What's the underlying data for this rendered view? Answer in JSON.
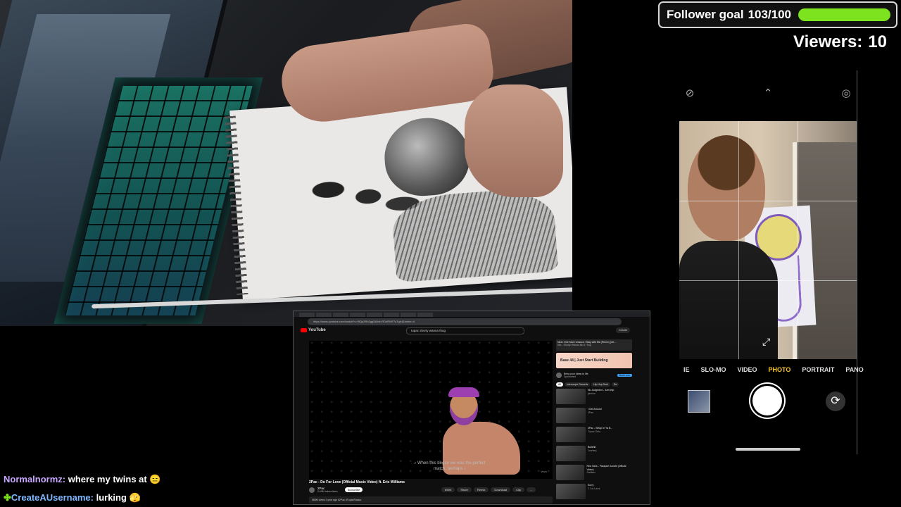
{
  "overlay": {
    "follower_goal_label": "Follower goal",
    "follower_goal_count": "103/100",
    "follower_goal_progress": 1.0,
    "follower_goal_color": "#7de31f",
    "viewers_label": "Viewers:",
    "viewers_count": "10"
  },
  "phone_camera": {
    "top_icons": [
      "flash-off-icon",
      "chevron-up-icon",
      "live-photo-off-icon"
    ],
    "modes": [
      "IE",
      "SLO-MO",
      "VIDEO",
      "PHOTO",
      "PORTRAIT",
      "PANO"
    ],
    "active_mode": "PHOTO",
    "active_mode_color": "#f7c631",
    "icons": {
      "expand": "expand-arrows-icon",
      "flip": "flip-camera-icon"
    }
  },
  "youtube": {
    "url": "https://www.youtube.com/watch?v=f9Qp3Rb2gq5&list=RDdRMF7y7gh4&index=4",
    "logo": "YouTube",
    "search_query": "tupac shorty wanna thug",
    "create_label": "Create",
    "caption": "♪ When this began we was the perfect match, perhaps ♪",
    "caption_brand": "Vevo",
    "video_title": "2Pac - Do For Love (Official Music Video) ft. Eric Williams",
    "channel_name": "2Pac",
    "channel_subs": "9.69M subscribers",
    "subscribe_label": "Subscribe",
    "actions": [
      "695K",
      "Share",
      "Remix",
      "Download",
      "Clip",
      "..."
    ],
    "description": "588M views 1 year ago #2Pac #TupacShakur",
    "sidebar": {
      "now_playing": "Next: One More Chance / Stay with Me (Remix) (20...",
      "now_playing_sub": "Mix - Shorty Wanna Be A Thug",
      "ad_title": "Base 44  |  Just Start Building",
      "ad_sub": "Bring your ideas to life",
      "ad_sponsor": "Sponsored",
      "ad_button": "Build now",
      "chips": [
        "All",
        "Interscope Records",
        "Hip Hop Soul",
        "Re"
      ],
      "recommendations": [
        {
          "title": "No Judgment - Jum Imp",
          "sub": "jsimlee"
        },
        {
          "title": "I Get Around",
          "sub": "2Pac"
        },
        {
          "title": "2Pac - Setup In Ya B...",
          "sub": "Tupac Oslo"
        },
        {
          "title": "Bullshit",
          "sub": "Jonmerj"
        },
        {
          "title": "Red Vans - Passport Junkie (Official Video)",
          "sub": "Sadfeet"
        },
        {
          "title": "Sorry",
          "sub": "2 Jus Lawz"
        }
      ]
    }
  },
  "chat": [
    {
      "user": "Normalnormz:",
      "user_color": "#c8a7ff",
      "message": "where my twins at",
      "emote": "😑"
    },
    {
      "user": "CreateAUsername:",
      "user_color": "#7fb8ff",
      "badge": "✤",
      "message": "lurking",
      "emote": "🫣"
    }
  ]
}
